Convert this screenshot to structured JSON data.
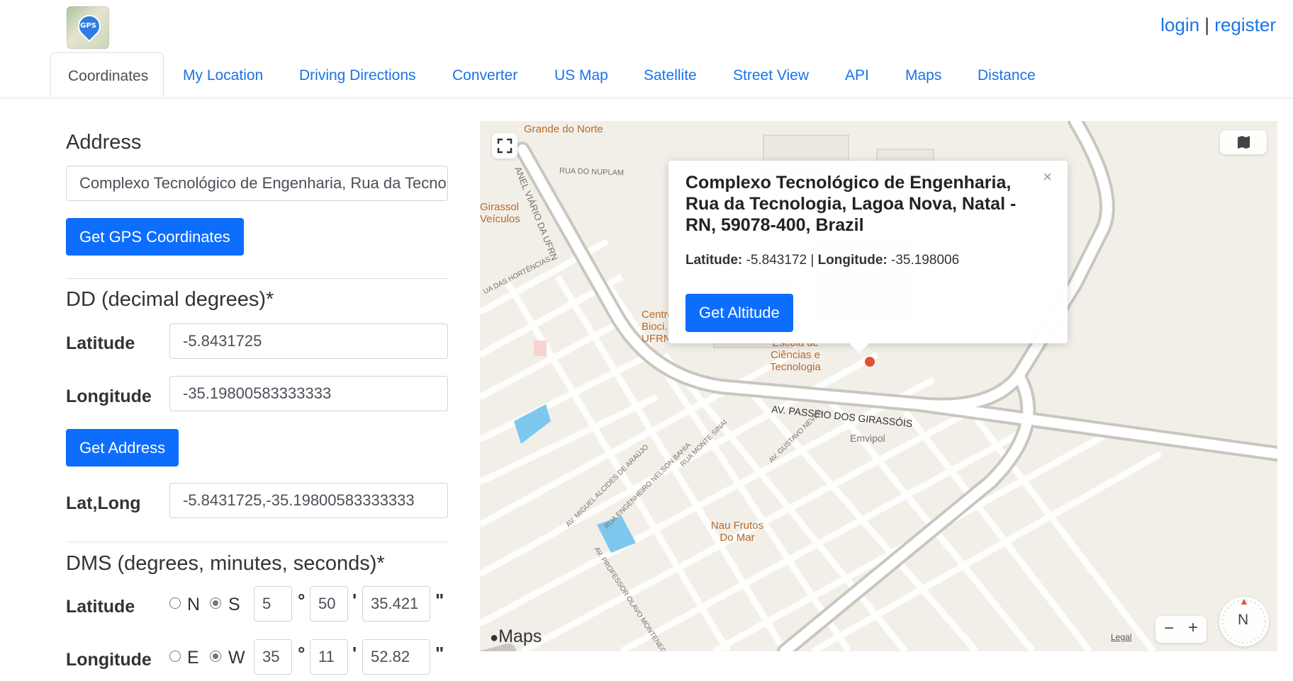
{
  "header": {
    "logo_text": "GPS",
    "login_label": "login",
    "separator": "|",
    "register_label": "register"
  },
  "tabs": [
    {
      "label": "Coordinates",
      "active": true
    },
    {
      "label": "My Location"
    },
    {
      "label": "Driving Directions"
    },
    {
      "label": "Converter"
    },
    {
      "label": "US Map"
    },
    {
      "label": "Satellite"
    },
    {
      "label": "Street View"
    },
    {
      "label": "API"
    },
    {
      "label": "Maps"
    },
    {
      "label": "Distance"
    }
  ],
  "address": {
    "title": "Address",
    "value": "Complexo Tecnológico de Engenharia, Rua da Tecnologia, Lagoa Nova, Natal - RN, 59078-400, Brazil",
    "button": "Get GPS Coordinates"
  },
  "dd": {
    "title": "DD (decimal degrees)*",
    "lat_label": "Latitude",
    "lat_value": "-5.8431725",
    "lng_label": "Longitude",
    "lng_value": "-35.19800583333333",
    "button": "Get Address",
    "latlng_label": "Lat,Long",
    "latlng_value": "-5.8431725,-35.19800583333333"
  },
  "dms": {
    "title": "DMS (degrees, minutes, seconds)*",
    "lat_label": "Latitude",
    "lat_n": "N",
    "lat_s": "S",
    "lat_selected": "S",
    "lat_deg": "5",
    "lat_min": "50",
    "lat_sec": "35.421",
    "lng_label": "Longitude",
    "lng_e": "E",
    "lng_w": "W",
    "lng_selected": "W",
    "lng_deg": "35",
    "lng_min": "11",
    "lng_sec": "52.82",
    "deg_symbol": "°",
    "min_symbol": "'",
    "sec_symbol": "\""
  },
  "map": {
    "popup_title": "Complexo Tecnológico de Engenharia, Rua da Tecnologia, Lagoa Nova, Natal - RN, 59078-400, Brazil",
    "popup_lat_label": "Latitude:",
    "popup_lat": "-5.843172",
    "popup_sep": "|",
    "popup_lng_label": "Longitude:",
    "popup_lng": "-35.198006",
    "popup_button": "Get Altitude",
    "close": "×",
    "brand": "Maps",
    "legal": "Legal",
    "compass": "N",
    "zoom_out": "−",
    "zoom_in": "+",
    "labels": {
      "ufrn_top": "Grande do Norte",
      "rua_nuplam": "RUA DO NUPLAM",
      "anel": "ANEL VIÁRIO DA UFRN",
      "girassol": "Girassol Veículos",
      "hortencias": "UA DAS HORTÊNCIAS",
      "centro": "Centro Bioci... | UFRN",
      "escola": "Escola de Ciências e Tecnologia",
      "av_passeio": "AV. PASSEIO DOS GIRASSÓIS",
      "emvipol": "Emvipol",
      "miguel": "AV. MIGUEL ALCIDES DE ARAÚJO",
      "nelson": "RUA ENGENHEIRO NELSON BAHIA",
      "monte": "RUA MONTE SINAI",
      "gustavo": "AV. GUSTAVO NEVES",
      "nau": "Nau Frutos Do Mar",
      "olavo": "AV. PROFESSOR OLAVO MONTENEGRO"
    }
  }
}
